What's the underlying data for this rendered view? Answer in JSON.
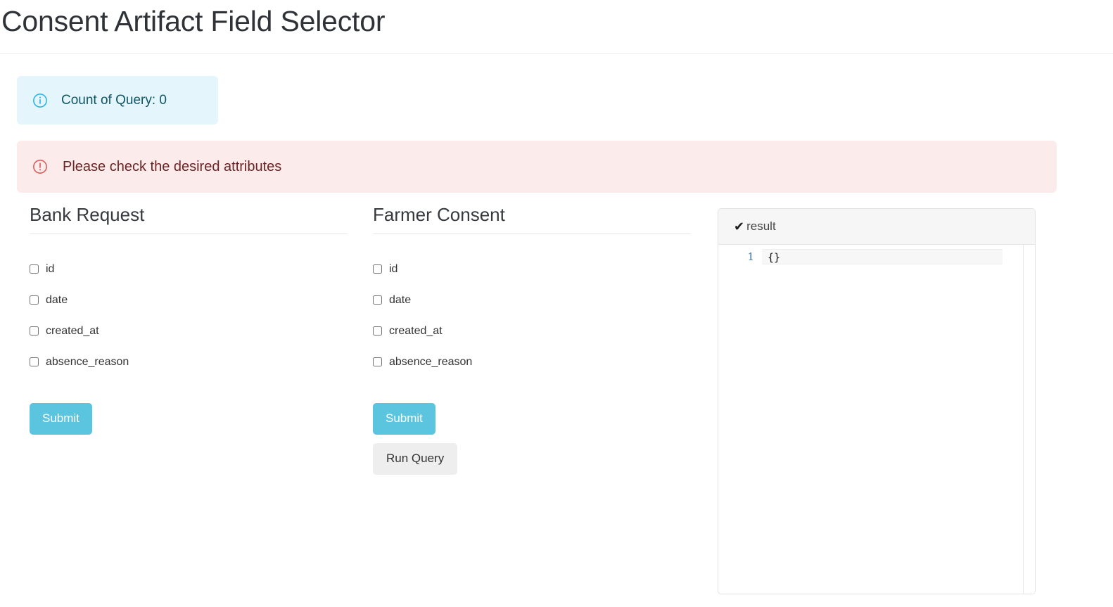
{
  "page": {
    "title": "Consent Artifact Field Selector"
  },
  "alerts": {
    "info": {
      "icon": "info-circle-icon",
      "text": "Count of Query: 0",
      "bg_color": "#e4f5fb",
      "text_color": "#0f5668",
      "icon_color": "#2bb3ec"
    },
    "danger": {
      "icon": "exclamation-circle-icon",
      "text": "Please check the desired attributes",
      "bg_color": "#fbebeb",
      "text_color": "#6b2326",
      "icon_color": "#e05a5a"
    }
  },
  "columns": [
    {
      "heading": "Bank Request",
      "fields": [
        {
          "label": "id",
          "checked": false
        },
        {
          "label": "date",
          "checked": false
        },
        {
          "label": "created_at",
          "checked": false
        },
        {
          "label": "absence_reason",
          "checked": false
        }
      ],
      "submit_label": "Submit",
      "run_query_label": null
    },
    {
      "heading": "Farmer Consent",
      "fields": [
        {
          "label": "id",
          "checked": false
        },
        {
          "label": "date",
          "checked": false
        },
        {
          "label": "created_at",
          "checked": false
        },
        {
          "label": "absence_reason",
          "checked": false
        }
      ],
      "submit_label": "Submit",
      "run_query_label": "Run Query"
    }
  ],
  "result_panel": {
    "status_icon": "checkmark-icon",
    "title": "result",
    "lines": [
      {
        "number": "1",
        "content": "{}"
      }
    ]
  },
  "colors": {
    "accent": "#5bc4de",
    "button_secondary": "#eeeeee",
    "title_text": "#2f3338",
    "gutter_number": "#3b6ea8"
  }
}
